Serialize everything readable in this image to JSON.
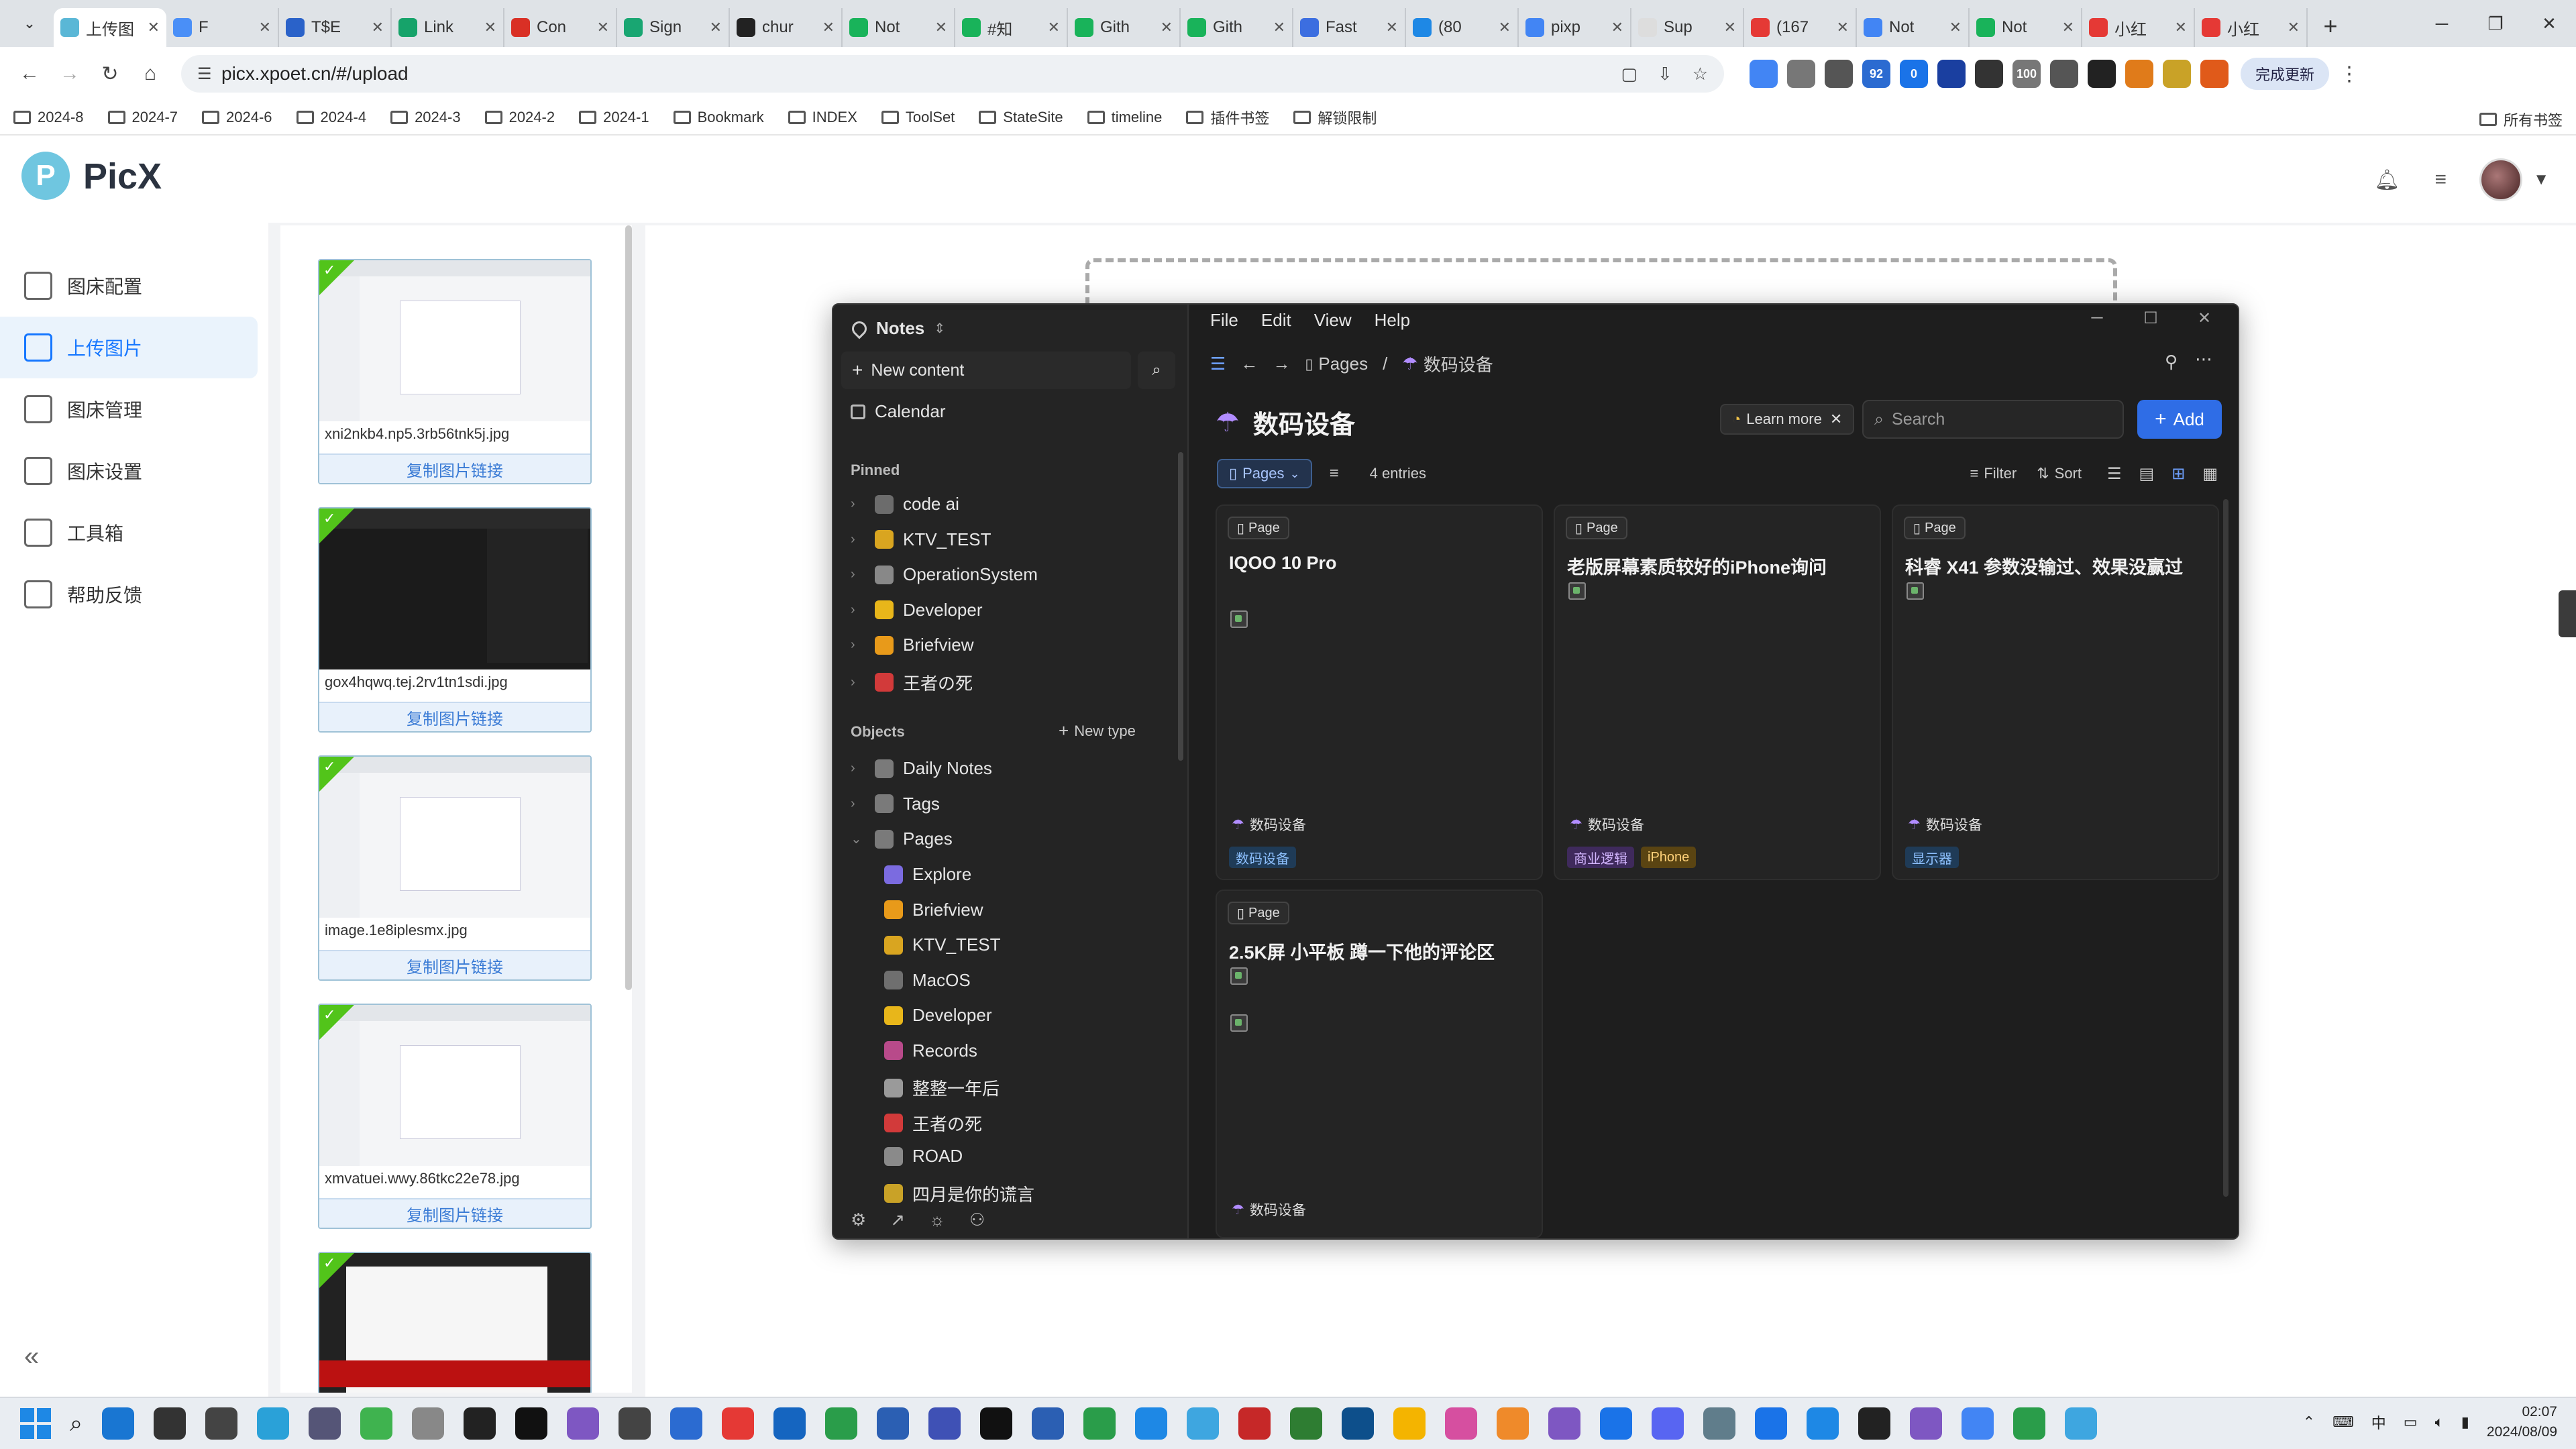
{
  "browser": {
    "tabs": [
      {
        "title": "上传图",
        "color": "#5ab7d6",
        "active": true
      },
      {
        "title": "F",
        "color": "#4a8ff7"
      },
      {
        "title": "T$E",
        "color": "#2a62c9"
      },
      {
        "title": "Link",
        "color": "#16a36a"
      },
      {
        "title": "Con",
        "color": "#d93025"
      },
      {
        "title": "Sign",
        "color": "#19a672"
      },
      {
        "title": "chur",
        "color": "#222222"
      },
      {
        "title": "Not",
        "color": "#19b35a"
      },
      {
        "title": "#知",
        "color": "#19b35a"
      },
      {
        "title": "Gith",
        "color": "#19b35a"
      },
      {
        "title": "Gith",
        "color": "#19b35a"
      },
      {
        "title": "Fast",
        "color": "#3c6ee0"
      },
      {
        "title": "(80",
        "color": "#1e88e5"
      },
      {
        "title": "pixp",
        "color": "#4285f4"
      },
      {
        "title": "Sup",
        "color": "#dddddd"
      },
      {
        "title": "(167",
        "color": "#e53935"
      },
      {
        "title": "Not",
        "color": "#4285f4"
      },
      {
        "title": "Not",
        "color": "#19b35a"
      },
      {
        "title": "小红",
        "color": "#e53935"
      },
      {
        "title": "小红",
        "color": "#e53935"
      }
    ],
    "url": "picx.xpoet.cn/#/upload",
    "update_label": "完成更新",
    "bookmarks": [
      "2024-8",
      "2024-7",
      "2024-6",
      "2024-4",
      "2024-3",
      "2024-2",
      "2024-1",
      "Bookmark",
      "INDEX",
      "ToolSet",
      "StateSite",
      "timeline",
      "插件书签",
      "解锁限制"
    ],
    "all_bookmarks": "所有书签",
    "ext_badges": [
      "92",
      "0",
      "100"
    ]
  },
  "app": {
    "name": "PicX",
    "nav": [
      {
        "label": "图床配置",
        "icon": "edit-icon"
      },
      {
        "label": "上传图片",
        "icon": "upload-icon",
        "active": true
      },
      {
        "label": "图床管理",
        "icon": "image-icon"
      },
      {
        "label": "图床设置",
        "icon": "gear-icon"
      },
      {
        "label": "工具箱",
        "icon": "toolbox-icon"
      },
      {
        "label": "帮助反馈",
        "icon": "chat-icon"
      }
    ],
    "uploads": [
      {
        "file": "xni2nkb4.np5.3rb56tnk5j.jpg",
        "copy": "复制图片链接",
        "theme": "light"
      },
      {
        "file": "gox4hqwq.tej.2rv1tn1sdi.jpg",
        "copy": "复制图片链接",
        "theme": "dark"
      },
      {
        "file": "image.1e8iplesmx.jpg",
        "copy": "复制图片链接",
        "theme": "light"
      },
      {
        "file": "xmvatuei.wwy.86tkc22e78.jpg",
        "copy": "复制图片链接",
        "theme": "light"
      },
      {
        "file": "",
        "copy": "",
        "theme": "video"
      }
    ]
  },
  "notes": {
    "workspace": "Notes",
    "new_content": "New content",
    "calendar": "Calendar",
    "pinned_label": "Pinned",
    "pinned": [
      {
        "label": "code ai",
        "color": "#6c6c6c"
      },
      {
        "label": "KTV_TEST",
        "color": "#d9a520"
      },
      {
        "label": "OperationSystem",
        "color": "#888888"
      },
      {
        "label": "Developer",
        "color": "#e8b61a"
      },
      {
        "label": "Briefview",
        "color": "#e89a1a"
      },
      {
        "label": "王者の死",
        "color": "#d23a3a"
      }
    ],
    "objects_label": "Objects",
    "new_type": "New type",
    "objects": [
      {
        "label": "Daily Notes",
        "color": "#7a7a7a"
      },
      {
        "label": "Tags",
        "color": "#7a7a7a"
      },
      {
        "label": "Pages",
        "color": "#7a7a7a"
      }
    ],
    "pages": [
      {
        "label": "Explore",
        "color": "#7b6be0"
      },
      {
        "label": "Briefview",
        "color": "#e89a1a"
      },
      {
        "label": "KTV_TEST",
        "color": "#d9a520"
      },
      {
        "label": "MacOS",
        "color": "#6f6f6f"
      },
      {
        "label": "Developer",
        "color": "#e8b61a"
      },
      {
        "label": "Records",
        "color": "#b84a8a"
      },
      {
        "label": "整整一年后",
        "color": "#9a9a9a"
      },
      {
        "label": "王者の死",
        "color": "#d23a3a"
      },
      {
        "label": "ROAD",
        "color": "#8a8a8a"
      },
      {
        "label": "四月是你的谎言",
        "color": "#c9a227"
      }
    ],
    "menu": [
      "File",
      "Edit",
      "View",
      "Help"
    ],
    "breadcrumb": [
      "Pages",
      "数码设备"
    ],
    "title": "数码设备",
    "learn_more": "Learn more",
    "search_placeholder": "Search",
    "add_label": "Add",
    "view_button": "Pages",
    "entries": "4 entries",
    "filter": "Filter",
    "sort": "Sort",
    "page_tag": "Page",
    "cards": [
      {
        "title": "IQOO 10 Pro",
        "parent": "数码设备",
        "tags": [
          {
            "label": "数码设备",
            "bg": "#1f3b57",
            "fg": "#8ec1ff"
          }
        ]
      },
      {
        "title": "老版屏幕素质较好的iPhone询问",
        "parent": "数码设备",
        "tags": [
          {
            "label": "商业逻辑",
            "bg": "#3f2a5c",
            "fg": "#d3b6ff"
          },
          {
            "label": "iPhone",
            "bg": "#5a4412",
            "fg": "#ffd27a"
          }
        ]
      },
      {
        "title": "科睿 X41 参数没输过、效果没赢过",
        "parent": "数码设备",
        "tags": [
          {
            "label": "显示器",
            "bg": "#1f3b57",
            "fg": "#8ec1ff"
          }
        ]
      },
      {
        "title": "2.5K屏 小平板 蹲一下他的评论区",
        "parent": "数码设备",
        "tags": []
      }
    ]
  },
  "taskbar": {
    "apps": [
      "#1976d2",
      "#333333",
      "#444444",
      "#2aa1d8",
      "#555577",
      "#3fb34f",
      "#888888",
      "#222222",
      "#111111",
      "#7e57c2",
      "#444444",
      "#2b6bd1",
      "#e53935",
      "#1565c0",
      "#2a9d4a",
      "#2b5fb3",
      "#3f51b5",
      "#111111",
      "#2b5fb3",
      "#2a9d4a",
      "#1e88e5",
      "#3ea6e0",
      "#c62828",
      "#2e7d32",
      "#0d4f8b",
      "#f4b400",
      "#d64fa0",
      "#ef8a2a",
      "#7e57c2",
      "#1a73e8",
      "#5865f2",
      "#607d8b",
      "#1a73e8",
      "#1e88e5",
      "#222222",
      "#7e57c2",
      "#4285f4",
      "#2a9d4a",
      "#3ea6e0"
    ],
    "time": "02:07",
    "date": "2024/08/09"
  }
}
